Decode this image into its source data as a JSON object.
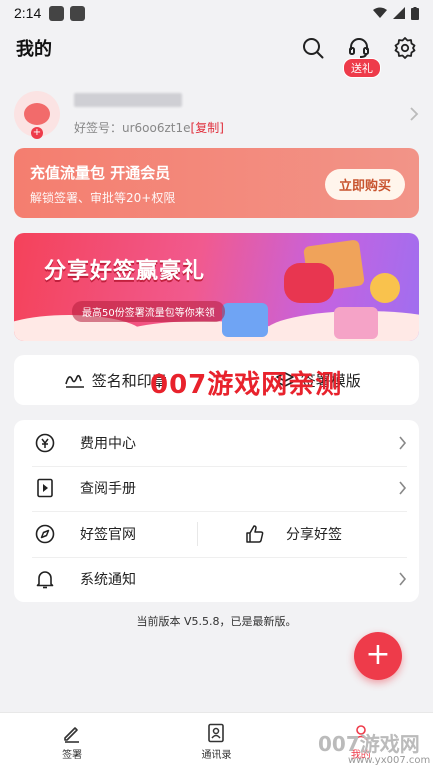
{
  "status_bar": {
    "time": "2:14"
  },
  "header": {
    "title": "我的",
    "gift_badge": "送礼"
  },
  "profile": {
    "sign_label": "好签号：ur6oo6zt1e",
    "copy_label": "[复制]"
  },
  "vip_card": {
    "title": "充值流量包 开通会员",
    "subtitle": "解锁签署、审批等20+权限",
    "buy_button": "立即购买"
  },
  "banner": {
    "headline": "分享好签赢豪礼",
    "subline": "最高50份签署流量包等你来领"
  },
  "templates": {
    "left_label": "签名和印章",
    "right_label": "签署模版"
  },
  "watermark": "007游戏网亲测",
  "menu": {
    "billing": "费用中心",
    "manual": "查阅手册",
    "official_site": "好签官网",
    "share": "分享好签",
    "notifications": "系统通知"
  },
  "version_text": "当前版本 V5.5.8，已是最新版。",
  "tabbar": {
    "items": [
      {
        "label": "签署"
      },
      {
        "label": "通讯录"
      },
      {
        "label": "我的"
      }
    ]
  },
  "corner_watermark": {
    "line1": "007游戏网",
    "line2": "www.yx007.com"
  },
  "colors": {
    "accent": "#ee3b4a",
    "vip_gradient_start": "#f47e6f",
    "background": "#f2f2f4"
  }
}
